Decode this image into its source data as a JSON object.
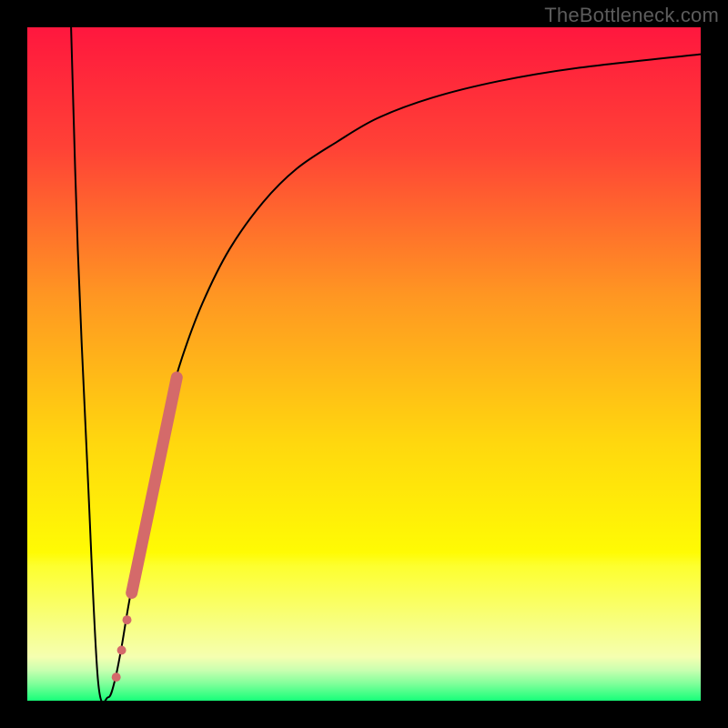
{
  "watermark": "TheBottleneck.com",
  "chart_data": {
    "type": "line",
    "title": "",
    "xlabel": "",
    "ylabel": "",
    "xlim": [
      0,
      100
    ],
    "ylim": [
      0,
      100
    ],
    "grid": false,
    "legend": false,
    "series": [
      {
        "name": "bottleneck-curve",
        "color": "#000000",
        "stroke_width": 2,
        "x": [
          6.5,
          7.5,
          9,
          10.5,
          12,
          13,
          14,
          15,
          17,
          19,
          21,
          23,
          26,
          30,
          35,
          40,
          46,
          52,
          60,
          70,
          82,
          100
        ],
        "y": [
          100,
          67,
          33,
          3,
          0.5,
          3,
          8,
          14,
          25,
          35,
          44,
          51,
          59,
          67,
          74,
          79,
          83,
          86.5,
          89.5,
          92,
          94,
          96
        ]
      }
    ],
    "highlight_segment": {
      "name": "highlight-band",
      "color": "#d46a6a",
      "stroke_width": 13,
      "linecap": "round",
      "x": [
        15.5,
        22.2
      ],
      "y": [
        16,
        48
      ]
    },
    "highlight_dots": {
      "name": "highlight-dots",
      "color": "#d46a6a",
      "radius": 5,
      "points": [
        {
          "x": 13.2,
          "y": 3.5
        },
        {
          "x": 14.0,
          "y": 7.5
        },
        {
          "x": 14.8,
          "y": 12.0
        }
      ]
    },
    "background_gradient": {
      "stops": [
        {
          "offset": 0,
          "color": "#ff173e"
        },
        {
          "offset": 0.18,
          "color": "#ff4236"
        },
        {
          "offset": 0.4,
          "color": "#ff9722"
        },
        {
          "offset": 0.62,
          "color": "#ffd80e"
        },
        {
          "offset": 0.78,
          "color": "#fffb04"
        },
        {
          "offset": 0.8,
          "color": "#fdff2f"
        },
        {
          "offset": 0.935,
          "color": "#f5ffb0"
        },
        {
          "offset": 0.955,
          "color": "#c8ffb0"
        },
        {
          "offset": 0.975,
          "color": "#7fff9a"
        },
        {
          "offset": 1.0,
          "color": "#17ff79"
        }
      ]
    }
  }
}
